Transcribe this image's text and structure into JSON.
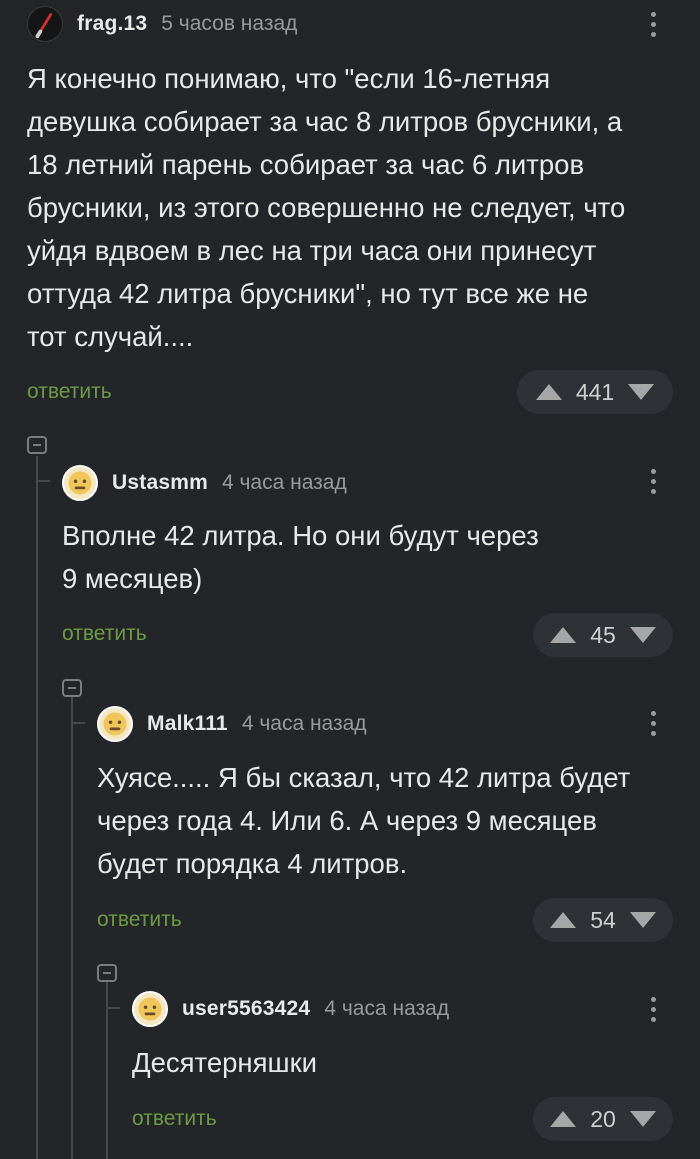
{
  "comments": [
    {
      "author": "frag.13",
      "time": "5 часов назад",
      "text": "Я конечно понимаю, что \"если 16-летняя\nдевушка собирает за час 8 литров брусники, а\n18 летний парень собирает за час 6 литров\nбрусники, из этого совершенно не следует, что\nуйдя вдвоем в лес на три часа они принесут\nоттуда 42 литра брусники\", но тут все же не\nтот случай....",
      "reply_label": "ответить",
      "score": "441"
    },
    {
      "author": "Ustasmm",
      "time": "4 часа назад",
      "text": "Вполне 42 литра. Но они будут через\n9 месяцев)",
      "reply_label": "ответить",
      "score": "45"
    },
    {
      "author": "Malk111",
      "time": "4 часа назад",
      "text": "Хуясе..... Я бы сказал, что 42 литра будет\nчерез года 4. Или 6. А через 9 месяцев\nбудет порядка 4 литров.",
      "reply_label": "ответить",
      "score": "54"
    },
    {
      "author": "user5563424",
      "time": "4 часа назад",
      "text": "Десятерняшки",
      "reply_label": "ответить",
      "score": "20"
    }
  ],
  "icons": {
    "avatar_1": "lightsaber-avatar",
    "avatar_default": "placeholder-face-avatar",
    "menu": "more-vertical-icon",
    "collapse": "collapse-minus-icon",
    "upvote": "triangle-up-icon",
    "downvote": "triangle-down-icon"
  },
  "colors": {
    "background": "#232528",
    "text": "#e8e8e8",
    "muted": "#9a9a9a",
    "reply": "#6d9b45",
    "vote_bg": "#2e3135",
    "thread_line": "#46484c"
  }
}
